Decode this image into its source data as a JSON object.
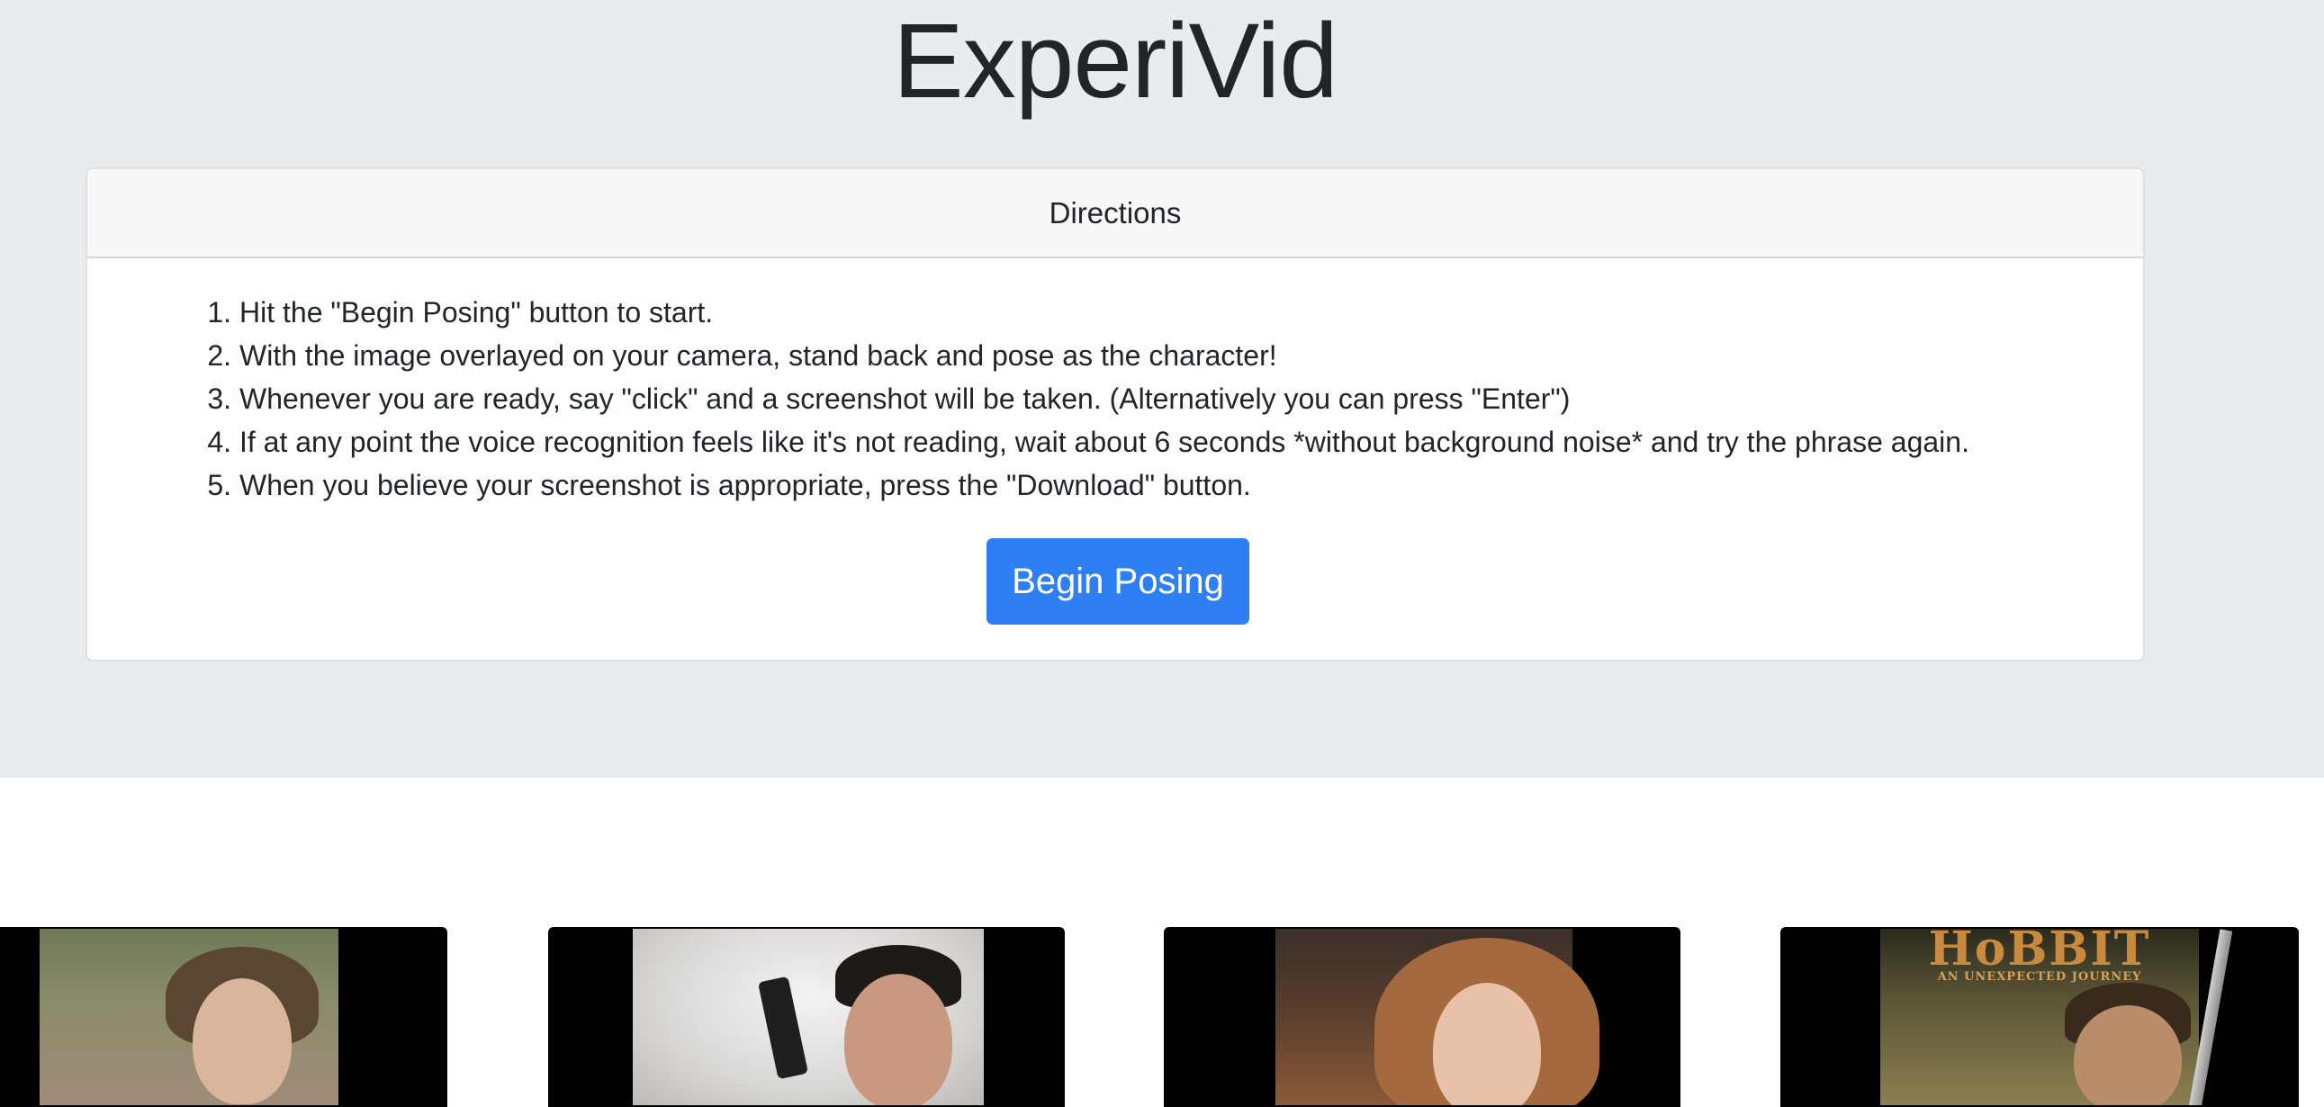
{
  "app": {
    "title": "ExperiVid"
  },
  "directions": {
    "header": "Directions",
    "steps": [
      "Hit the \"Begin Posing\" button to start.",
      "With the image overlayed on your camera, stand back and pose as the character!",
      "Whenever you are ready, say \"click\" and a screenshot will be taken. (Alternatively you can press \"Enter\")",
      "If at any point the voice recognition feels like it's not reading, wait about 6 seconds *without background noise* and try the phrase again.",
      "When you believe your screenshot is appropriate, press the \"Download\" button."
    ],
    "begin_button": "Begin Posing"
  },
  "gallery": {
    "hobbit_logo": "HoBBIT",
    "hobbit_subtitle": "AN UNEXPECTED JOURNEY"
  },
  "colors": {
    "jumbotron_bg": "#e9ecef",
    "primary_button": "#2f7ff4"
  }
}
